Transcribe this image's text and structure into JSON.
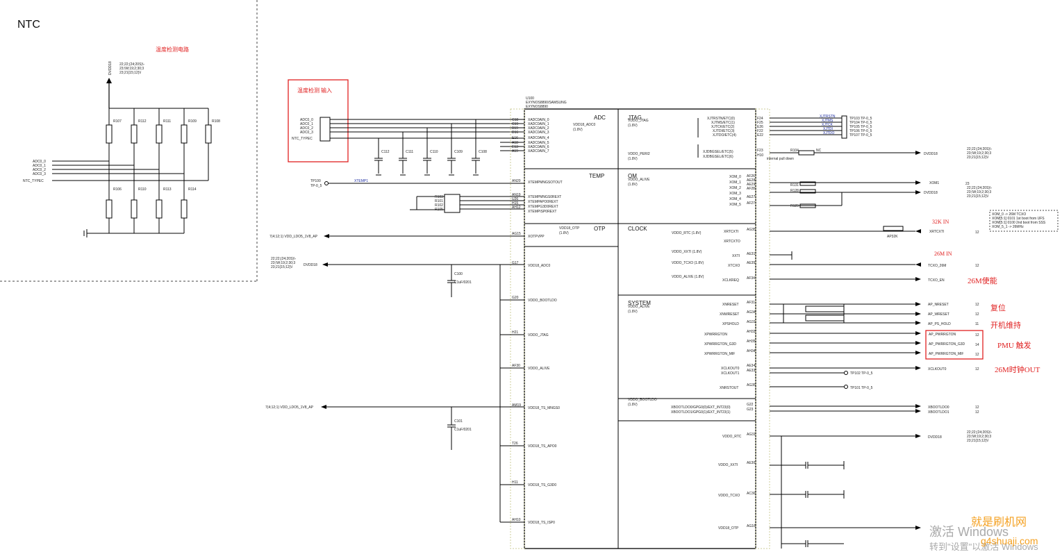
{
  "ntc": {
    "title": "NTC",
    "heading_cn": "温度检测电路",
    "ref_lines": [
      "22;22;(24;20S)\\-",
      "23;\\W;19;2;30;3",
      "23;21{15;12}\\/"
    ],
    "resistors_top": [
      "R107",
      "R112",
      "R111",
      "R109",
      "R108"
    ],
    "resistors_bottom": [
      "R106",
      "R110",
      "R113",
      "R114"
    ],
    "left_labels": [
      "ADC0_0",
      "ADC0_1",
      "ADC0_2",
      "ADC0_3",
      "NTC_TYPEC"
    ]
  },
  "input_box": {
    "label": "温度检测 输入",
    "pins": [
      "ADC0_0",
      "ADC0_1",
      "ADC0_2",
      "ADC0_3",
      "NTC_TYPEC"
    ]
  },
  "caps_top": [
    "C112",
    "C111",
    "C110",
    "C109",
    "C108"
  ],
  "chip": {
    "ref": "U100",
    "part1": "EXYNOS8890/SAMSUNG",
    "part2": "EXYNOS8890",
    "sections": {
      "adc": "ADC",
      "temp": "TEMP",
      "otp": "OTP",
      "jtag": "JTAG",
      "om": "OM",
      "clock": "CLOCK",
      "system": "SYSTEM"
    },
    "left_pins": [
      {
        "num": "C18",
        "name": "XADC0AIN_0"
      },
      {
        "num": "C19",
        "name": "XADC0AIN_1"
      },
      {
        "num": "B19",
        "name": "XADC0AIN_2"
      },
      {
        "num": "D16",
        "name": "XADC0AIN_3"
      },
      {
        "num": "E16",
        "name": "XADC0AIN_4"
      },
      {
        "num": "A18",
        "name": "XADC0AIN_5"
      },
      {
        "num": "E13",
        "name": "XADC0AIN_6"
      },
      {
        "num": "A19",
        "name": "XADC0AIN_7"
      }
    ],
    "temp_pins": [
      {
        "num": "AN20",
        "name": "XTEMPMNGSOTOUT"
      },
      {
        "num": "AN19",
        "name": "XTEMPMNGS0REXT"
      },
      {
        "num": "U26",
        "name": "XTEMPAPO0REXT"
      },
      {
        "num": "H15",
        "name": "XTEMPG3D0REXT"
      },
      {
        "num": "AH12",
        "name": "XTEMPISP0REXT"
      }
    ],
    "power_pins": [
      {
        "num": "AG15",
        "name": "XOTPVPP"
      },
      {
        "num": "G17",
        "name": "VDD18_ADC0"
      },
      {
        "num": "G20",
        "name": "VDDO_BOOTLDO"
      },
      {
        "num": "H21",
        "name": "VDDO_JTAG"
      },
      {
        "num": "AF30",
        "name": "VDDO_ALIVE"
      },
      {
        "num": "AM19",
        "name": "VDD18_TS_MNGS0"
      },
      {
        "num": "T26",
        "name": "VDD18_TS_APO0"
      },
      {
        "num": "H11",
        "name": "VDD18_TS_G3D0"
      },
      {
        "num": "AH10",
        "name": "VDD18_TS_ISP0"
      }
    ],
    "jtag_pins": [
      {
        "num": "F24",
        "name": "XJTRSTN/ETC(0)"
      },
      {
        "num": "F25",
        "name": "XJTMS/ETC(1)"
      },
      {
        "num": "E26",
        "name": "XJTCK/ETC(2)"
      },
      {
        "num": "F22",
        "name": "XJTDI/ETC(3)"
      },
      {
        "num": "E22",
        "name": "XJTDO/ETC(4)"
      },
      {
        "num": "F23",
        "name": "XJDBGSEL/ETC(5)"
      },
      {
        "num": "H10",
        "name": "XJDBGSEL/ETC(6)"
      }
    ],
    "om_pins": [
      {
        "num": "AF26",
        "name": "XOM_0"
      },
      {
        "num": "AE28",
        "name": "XOM_1"
      },
      {
        "num": "AE29",
        "name": "XOM_2"
      },
      {
        "num": "AF28",
        "name": "XOM_3"
      },
      {
        "num": "AE27",
        "name": "XOM_4"
      },
      {
        "num": "AF27",
        "name": "XOM_5"
      }
    ],
    "clock_pins": [
      {
        "num": "AG35",
        "name": "XRTCXTI"
      },
      {
        "num": "",
        "name": "XRTCXTO"
      },
      {
        "num": "AE31",
        "name": "XXTI"
      },
      {
        "num": "AE35",
        "name": "XTCXO"
      },
      {
        "num": "AF34",
        "name": "XCLKREQ"
      }
    ],
    "system_pins": [
      {
        "num": "AF31",
        "name": "XNRESET"
      },
      {
        "num": "AG34",
        "name": "XNWRESET"
      },
      {
        "num": "AG31",
        "name": "XPSHOLD"
      },
      {
        "num": "AH33",
        "name": "XPWRRGTON"
      },
      {
        "num": "AH35",
        "name": "XPWRRGTON_G3D"
      },
      {
        "num": "AH34",
        "name": "XPWRRGTON_MIF"
      },
      {
        "num": "AE34",
        "name": "XCLKOUT0"
      },
      {
        "num": "AE33",
        "name": "XCLKOUT1"
      },
      {
        "num": "AG35",
        "name": "XNRSTOUT"
      },
      {
        "num": "G22",
        "name": "XBOOTLDO0/GPG0(0)/EXT_INT23(0)"
      },
      {
        "num": "G23",
        "name": "XBOOTLDO1/GPG0(1)/EXT_INT23(1)"
      }
    ],
    "right_power_pins": [
      {
        "num": "AG31",
        "name": "VDDO_RTC"
      },
      {
        "num": "AE30",
        "name": "VDDO_XXTI"
      },
      {
        "num": "AC30",
        "name": "VDDO_TCXO"
      },
      {
        "num": "AG16",
        "name": "VDD18_OTP"
      }
    ],
    "domain_labels": {
      "adc": "VDD18_ADC0",
      "otp_v": "VDD18_OTP",
      "jtag_v": "VDDO_JTAG",
      "perif": "VDDO_PERI2",
      "om_v": "VDDO_ALIVE",
      "rtc_v": "VDDO_RTC (1.8V)",
      "xxti_v": "VDDO_XXTI (1.8V)",
      "tcxo_v": "VDDO_TCXO (1.8V)",
      "alive_v": "VDDO_ALIVE (1.8V)",
      "sys_v": "VDDO_ALIVE",
      "boot_v": "VDDO_BOOTLDO",
      "v18": "(1.8V)"
    }
  },
  "right_nets": {
    "tp": [
      "TP103 TP-0_5",
      "TP104 TP-0_5",
      "TP105 TP-0_5",
      "TP106 TP-0_5",
      "TP107 TP-0_5"
    ],
    "jtag_net_labels": [
      "XJTRSTN",
      "XJTMS",
      "XJTCK",
      "XJTDI",
      "XJTDO"
    ],
    "r104": "R104",
    "nc": "NC",
    "internal_pd": "internal pull down",
    "dvdd18": "DVDD18",
    "xom1": "XOM1",
    "om_r": [
      "R131",
      "R128",
      "R129"
    ],
    "ap32k": "AP32K",
    "xrtcxti": "XRTCXTI",
    "tcxo_26m": "TCXO_26M",
    "tcxo_en": "TCXO_EN",
    "ap_nreset": "AP_NRESET",
    "ap_wreset": "AP_WRESET",
    "ap_ps_hold": "AP_PS_HOLD",
    "ap_pwrrgton": "AP_PWRRGTON",
    "ap_pwrrgton_g3d": "AP_PWRRGTON_G3D",
    "ap_pwrrgton_mif": "AP_PWRRGTON_MIF",
    "xclkout0": "XCLKOUT0",
    "tp102": "TP102 TP-0_5",
    "tp101": "TP101 TP-0_5",
    "xbootldo0": "XBOOTLDO0",
    "xbootldo1": "XBOOTLDO1",
    "om_table": [
      "XOM_0 -> 26M TCXO",
      "XOM[5:1] 0101 1st boot from UFS",
      "XOM[5:1] 0100 2nd boot from SSS",
      "XOM_5_1 -> 26MHz"
    ],
    "nums": [
      "23",
      "12",
      "12",
      "12",
      "12",
      "11",
      "12",
      "14",
      "12",
      "12"
    ]
  },
  "annotations": {
    "rtc_in": "32K IN",
    "mhz_in": "26M IN",
    "en": "26M使能",
    "reset": "复位",
    "hold": "开机维持",
    "pmu": "PMU 触发",
    "clkout": "26M时钟OUT"
  },
  "left_nets": {
    "tp100": "TP100",
    "tp0_5": "TP-0_5",
    "xtemp1": "XTEMP1",
    "ldo_ap": "7(4;12;1) VDD_LDO5_1V8_AP",
    "dvdd18": "DVDD18",
    "c100": "C100",
    "c101": "C101",
    "cap_val": "C1uF/0201"
  },
  "temp_resistors": [
    "R103",
    "R101",
    "R102",
    "R105"
  ],
  "watermark": {
    "activate": "激活 Windows",
    "goto": "转到\"设置\"以激活 Windows",
    "site": "就是刷机网",
    "url": "g4shuaji.com"
  }
}
